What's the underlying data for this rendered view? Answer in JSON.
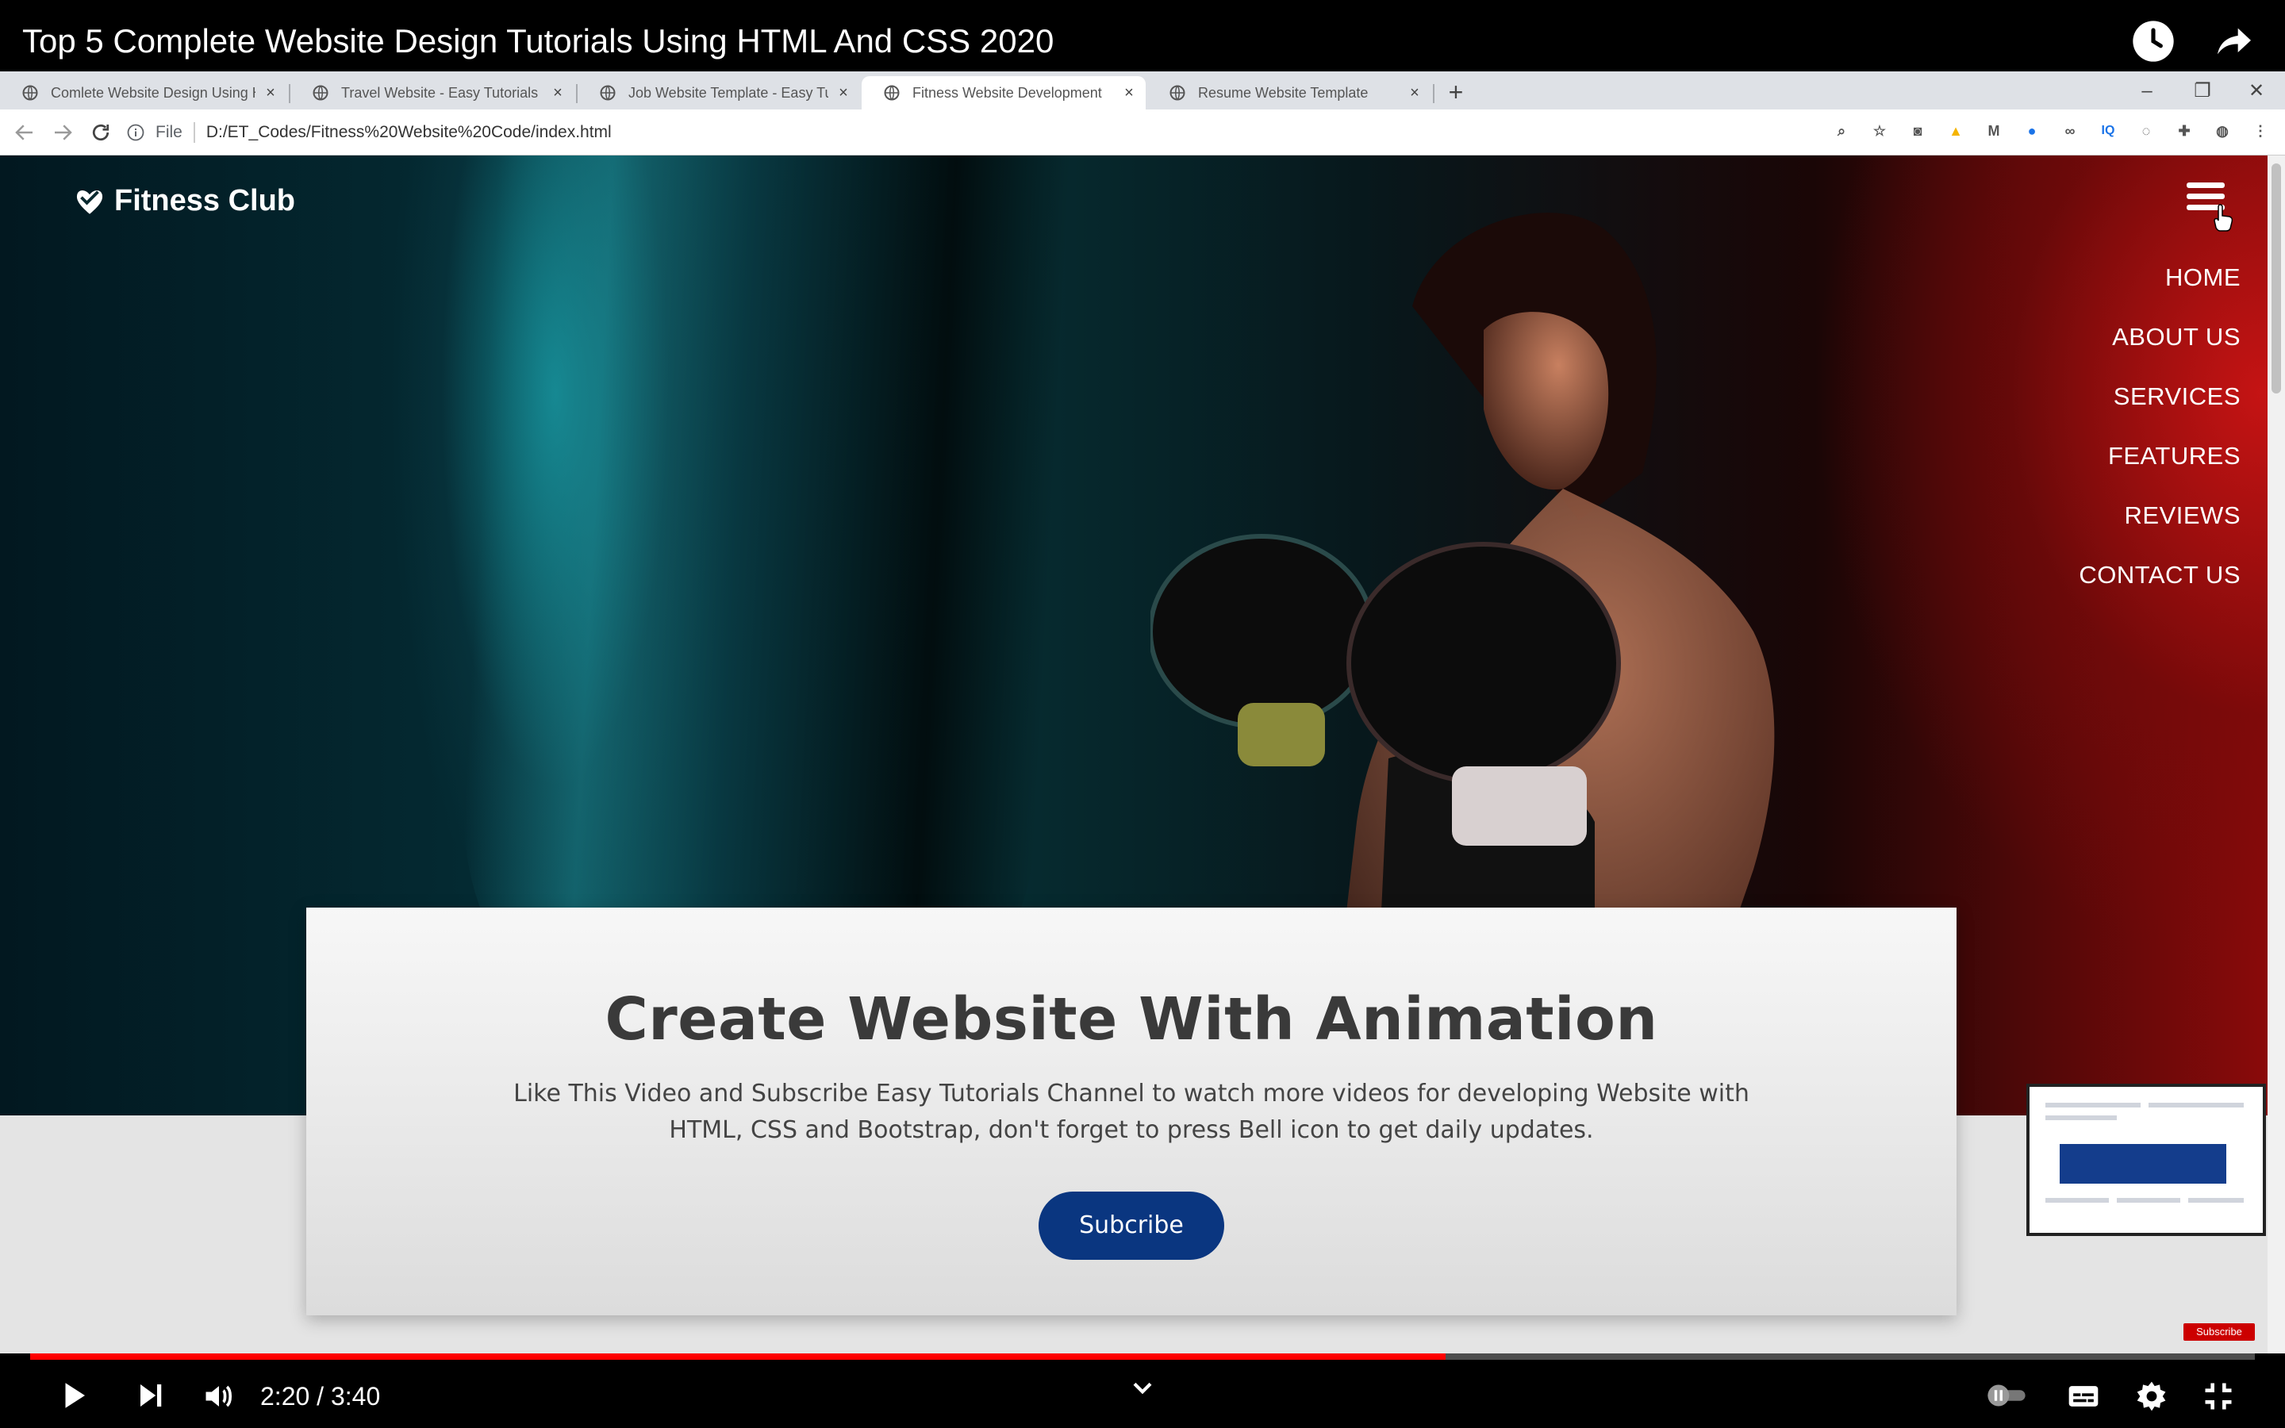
{
  "video": {
    "title": "Top 5 Complete Website Design Tutorials Using HTML And CSS 2020",
    "time_current": "2:20",
    "time_total": "3:40",
    "time_display": "2:20 / 3:40",
    "progress_fraction": 0.6364,
    "subscribe_badge": "Subscribe"
  },
  "browser": {
    "tabs": [
      {
        "label": "Comlete Website Design Using H",
        "active": false
      },
      {
        "label": "Travel Website - Easy Tutorials",
        "active": false
      },
      {
        "label": "Job Website Template - Easy Tut",
        "active": false
      },
      {
        "label": "Fitness Website Development",
        "active": true
      },
      {
        "label": "Resume Website Template",
        "active": false
      }
    ],
    "scheme": "File",
    "url": "D:/ET_Codes/Fitness%20Website%20Code/index.html"
  },
  "site": {
    "logo_text": "Fitness Club",
    "nav": [
      "HOME",
      "ABOUT US",
      "SERVICES",
      "FEATURES",
      "REVIEWS",
      "CONTACT US"
    ],
    "card_title": "Create Website With Animation",
    "card_text": "Like This Video and Subscribe Easy Tutorials Channel to watch more videos for developing Website with HTML, CSS and Bootstrap, don't forget to press Bell icon to get daily updates.",
    "card_button": "Subcribe"
  },
  "colors": {
    "progress_played": "#ff0000",
    "button_blue": "#0a3680",
    "hero_red": "#c81414",
    "hero_teal": "#1496a0"
  }
}
